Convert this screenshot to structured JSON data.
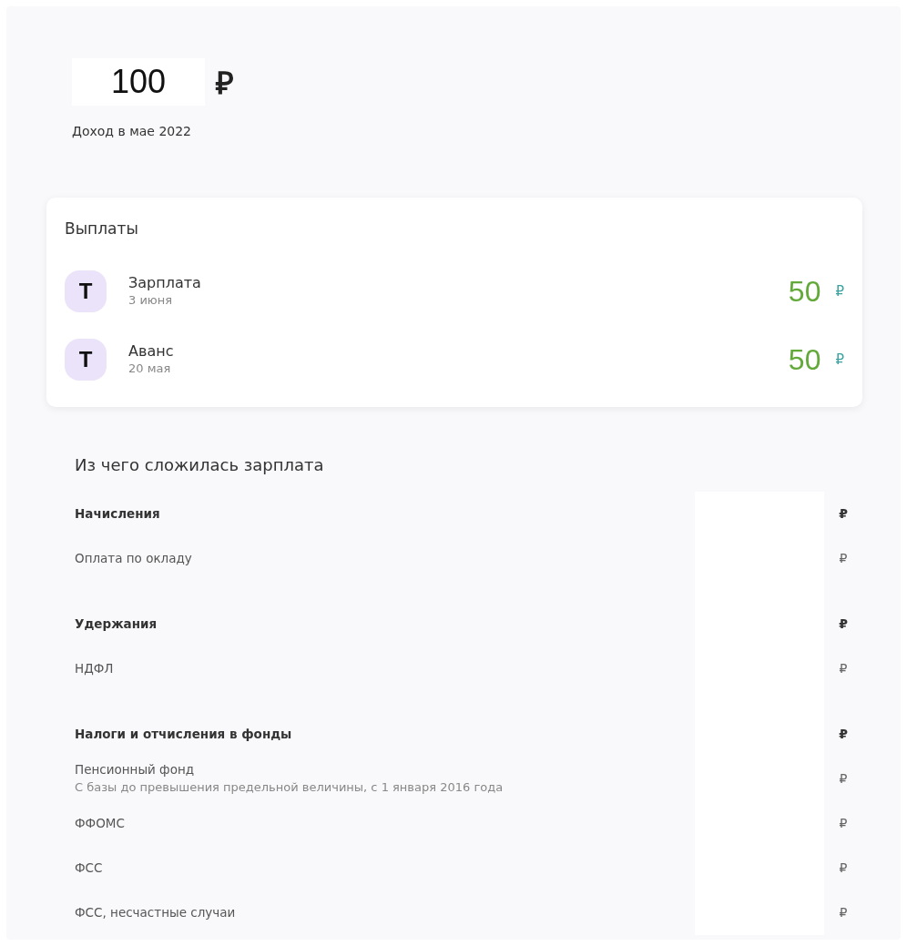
{
  "income": {
    "amount": "100",
    "currency": "₽",
    "caption": "Доход в мае 2022"
  },
  "payouts": {
    "title": "Выплаты",
    "items": [
      {
        "logo": "T",
        "name": "Зарплата",
        "date": "3 июня",
        "amount": "50",
        "currency": "₽"
      },
      {
        "logo": "T",
        "name": "Аванс",
        "date": "20 мая",
        "amount": "50",
        "currency": "₽"
      }
    ]
  },
  "breakdown": {
    "title": "Из чего сложилась зарплата",
    "rows": [
      {
        "kind": "group",
        "label": "Начисления",
        "currency": "₽"
      },
      {
        "kind": "item",
        "label": "Оплата по окладу",
        "currency": "₽"
      },
      {
        "kind": "group",
        "label": "Удержания",
        "currency": "₽"
      },
      {
        "kind": "item",
        "label": "НДФЛ",
        "currency": "₽"
      },
      {
        "kind": "group",
        "label": "Налоги и отчисления в фонды",
        "currency": "₽"
      },
      {
        "kind": "item",
        "label": "Пенсионный фонд",
        "note": "С базы до превышения предельной величины, с 1 января 2016 года",
        "currency": "₽"
      },
      {
        "kind": "item",
        "label": "ФФОМС",
        "currency": "₽"
      },
      {
        "kind": "item",
        "label": "ФСС",
        "currency": "₽"
      },
      {
        "kind": "item",
        "label": "ФСС, несчастные случаи",
        "currency": "₽"
      }
    ]
  }
}
